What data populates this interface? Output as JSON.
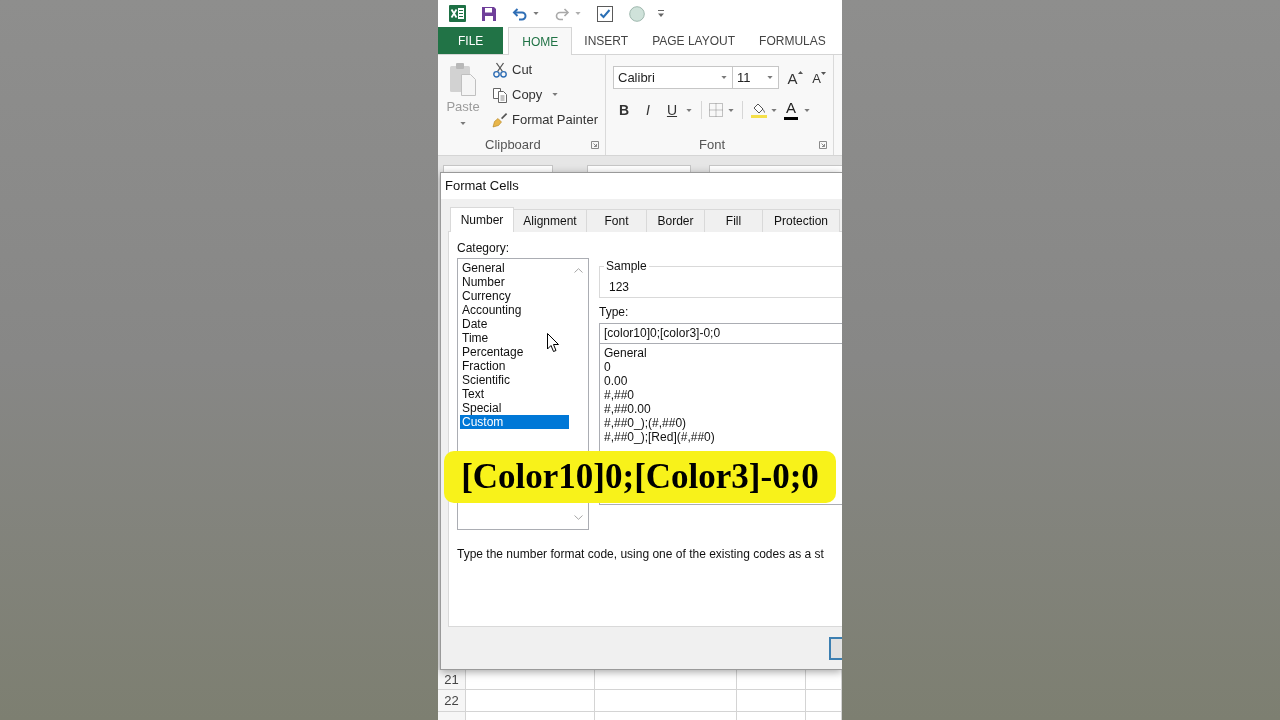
{
  "ribbon_tabs": [
    {
      "label": "FILE",
      "kind": "file",
      "selected": false
    },
    {
      "label": "HOME",
      "kind": "tab",
      "selected": true
    },
    {
      "label": "INSERT",
      "kind": "tab",
      "selected": false
    },
    {
      "label": "PAGE LAYOUT",
      "kind": "tab",
      "selected": false
    },
    {
      "label": "FORMULAS",
      "kind": "tab",
      "selected": false
    }
  ],
  "clipboard_group": {
    "paste": {
      "label": "Paste",
      "disabled": true
    },
    "cut": "Cut",
    "copy": "Copy",
    "format_painter": "Format Painter",
    "label": "Clipboard"
  },
  "font_group": {
    "font_name": "Calibri",
    "font_size": "11",
    "grow_font": "A",
    "shrink_font": "A",
    "bold": "B",
    "italic": "I",
    "underline": "U",
    "font_color": "A",
    "label": "Font"
  },
  "dialog": {
    "title": "Format Cells",
    "tabs": [
      {
        "label": "Number",
        "selected": true
      },
      {
        "label": "Alignment",
        "selected": false
      },
      {
        "label": "Font",
        "selected": false
      },
      {
        "label": "Border",
        "selected": false
      },
      {
        "label": "Fill",
        "selected": false
      },
      {
        "label": "Protection",
        "selected": false
      }
    ],
    "category_label": "Category:",
    "categories": [
      {
        "label": "General",
        "selected": false
      },
      {
        "label": "Number",
        "selected": false
      },
      {
        "label": "Currency",
        "selected": false
      },
      {
        "label": "Accounting",
        "selected": false
      },
      {
        "label": "Date",
        "selected": false
      },
      {
        "label": "Time",
        "selected": false
      },
      {
        "label": "Percentage",
        "selected": false
      },
      {
        "label": "Fraction",
        "selected": false
      },
      {
        "label": "Scientific",
        "selected": false
      },
      {
        "label": "Text",
        "selected": false
      },
      {
        "label": "Special",
        "selected": false
      },
      {
        "label": "Custom",
        "selected": true
      }
    ],
    "sample_label": "Sample",
    "sample_value": "123",
    "type_label": "Type:",
    "type_value": "[color10]0;[color3]-0;0",
    "type_options": [
      "General",
      "0",
      "0.00",
      "#,##0",
      "#,##0.00",
      "#,##0_);(#,##0)",
      "#,##0_);[Red](#,##0)"
    ],
    "description": "Type the number format code, using one of the existing codes as a st"
  },
  "caption": {
    "text": "[Color10]0;[Color3]-0;0"
  },
  "sheet": {
    "rows": [
      {
        "header": "21"
      },
      {
        "header": "22"
      }
    ]
  }
}
